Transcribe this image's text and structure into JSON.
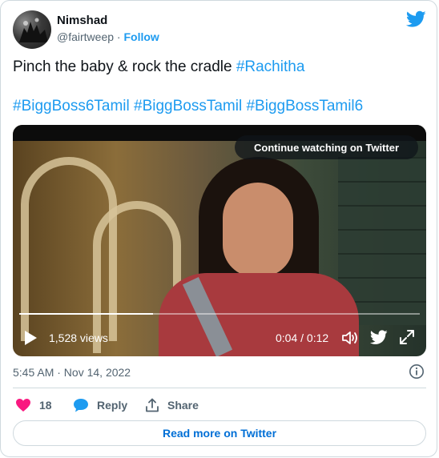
{
  "author": {
    "name": "Nimshad",
    "handle": "@fairtweep",
    "separator": "·",
    "follow_label": "Follow"
  },
  "tweet": {
    "text_prefix": "Pinch the baby & rock the cradle ",
    "hashtag_inline": "#Rachitha",
    "hashtags": [
      "#BiggBoss6Tamil",
      "#BiggBossTamil",
      "#BiggBossTamil6"
    ]
  },
  "video": {
    "continue_label": "Continue watching on Twitter",
    "views": "1,528 views",
    "time": "0:04 / 0:12",
    "progress": 0.333,
    "icons": [
      "play-icon",
      "volume-icon",
      "twitter-icon",
      "expand-icon"
    ]
  },
  "meta": {
    "timestamp": "5:45 AM · Nov 14, 2022"
  },
  "actions": {
    "like_count": "18",
    "reply_label": "Reply",
    "share_label": "Share"
  },
  "footer": {
    "read_more_label": "Read more on Twitter"
  },
  "colors": {
    "accent": "#1d9bf0",
    "like": "#f91880",
    "muted": "#536471",
    "link_dark": "#006fd6"
  }
}
